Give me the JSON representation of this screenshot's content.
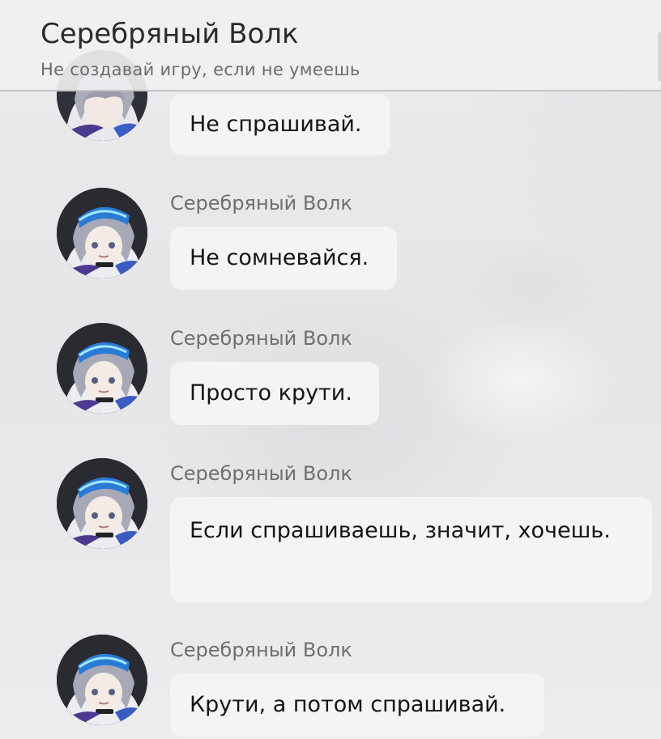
{
  "header": {
    "title": "Серебряный Волк",
    "subtitle": "Не создавай игру, если не умеешь"
  },
  "messages": [
    {
      "sender": "",
      "text": "Не спрашивай."
    },
    {
      "sender": "Серебряный Волк",
      "text": "Не сомневайся."
    },
    {
      "sender": "Серебряный Волк",
      "text": "Просто крути."
    },
    {
      "sender": "Серебряный Волк",
      "text": "Если спрашиваешь, значит, хочешь."
    },
    {
      "sender": "Серебряный Волк",
      "text": "Крути, а потом спрашивай."
    }
  ],
  "icons": {
    "avatar": "silver-wolf-avatar-icon"
  },
  "colors": {
    "background": "#e9e9eb",
    "bubble": "#f4f4f5",
    "header_divider": "#c3c3c6",
    "title_text": "#2a2a2a",
    "sender_text": "#6f6f72"
  }
}
